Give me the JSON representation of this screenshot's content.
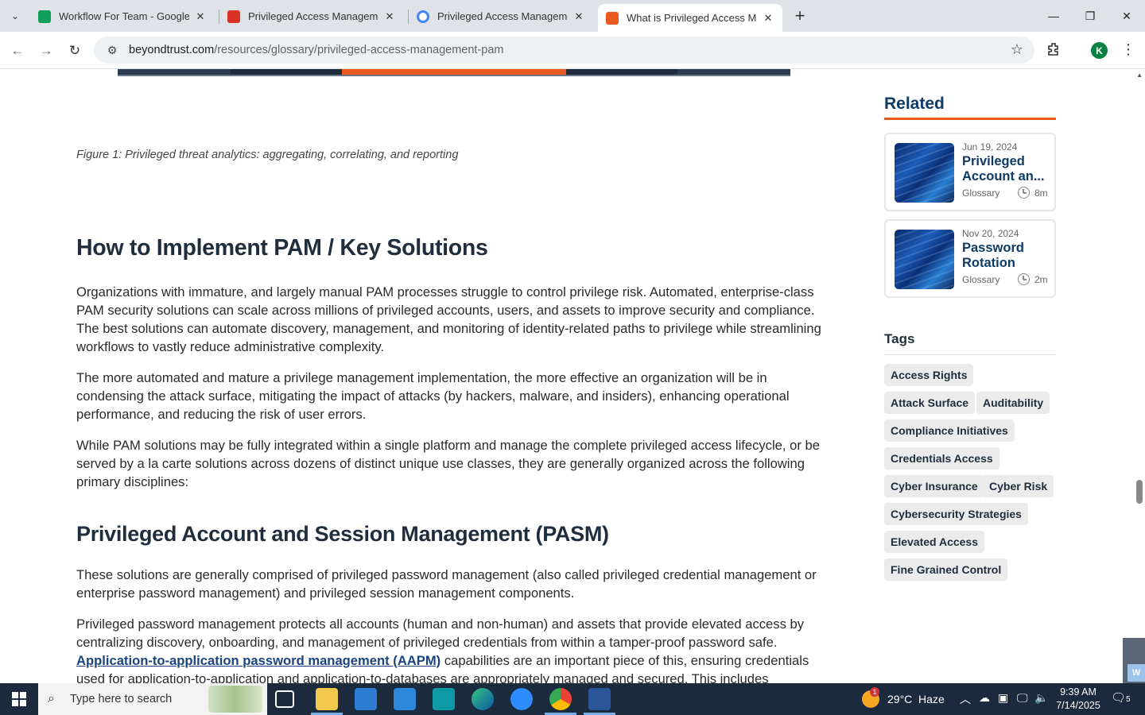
{
  "browser": {
    "tabs": [
      {
        "title": "Workflow For Team - Google Sh",
        "favicon_color": "#0f9d58"
      },
      {
        "title": "Privileged Access Management",
        "favicon_color": "#d93025"
      },
      {
        "title": "Privileged Access Management",
        "favicon_color": "#4285f4"
      },
      {
        "title": "What is Privileged Access Mana",
        "favicon_color": "#e8581f"
      }
    ],
    "url_host": "beyondtrust.com",
    "url_path": "/resources/glossary/privileged-access-management-pam",
    "profile_initial": "K"
  },
  "article": {
    "figure_caption": "Figure 1: Privileged threat analytics: aggregating, correlating, and reporting",
    "heading_1": "How to Implement PAM / Key Solutions",
    "para_1": "Organizations with immature, and largely manual PAM processes struggle to control privilege risk. Automated, enterprise-class PAM security solutions can scale across millions of privileged accounts, users, and assets to improve security and compliance. The best solutions can automate discovery, management, and monitoring of identity-related paths to privilege while streamlining workflows to vastly reduce administrative complexity.",
    "para_2": "The more automated and mature a privilege management implementation, the more effective an organization will be in condensing the attack surface, mitigating the impact of attacks (by hackers, malware, and insiders), enhancing operational performance, and reducing the risk of user errors.",
    "para_3": "While PAM solutions may be fully integrated within a single platform and manage the complete privileged access lifecycle, or be served by a la carte solutions across dozens of distinct unique use classes, they are generally organized across the following primary disciplines:",
    "heading_2": "Privileged Account and Session Management (PASM)",
    "para_4": "These solutions are generally comprised of privileged password management (also called privileged credential management or enterprise password management) and privileged session management components.",
    "para_5_a": "Privileged password management protects all accounts (human and non-human) and assets that provide elevated access by centralizing discovery, onboarding, and management of privileged credentials from within a tamper-proof password safe. ",
    "para_5_link": "Application-to-application password management (AAPM)",
    "para_5_b": " capabilities are an important piece of this, ensuring credentials used for application-to-application and application-to-databases are appropriately managed and secured. This includes"
  },
  "sidebar": {
    "related_heading": "Related",
    "related": [
      {
        "date": "Jun 19, 2024",
        "title": "Privileged Account an...",
        "type": "Glossary",
        "duration": "8m"
      },
      {
        "date": "Nov 20, 2024",
        "title": "Password Rotation",
        "type": "Glossary",
        "duration": "2m"
      }
    ],
    "tags_heading": "Tags",
    "tags": [
      "Access Rights",
      "Attack Surface",
      "Auditability",
      "Compliance Initiatives",
      "Credentials Access",
      "Cyber Insurance",
      "Cyber Risk",
      "Cybersecurity Strategies",
      "Elevated Access",
      "Fine Grained Control"
    ]
  },
  "taskbar": {
    "search_placeholder": "Type here to search",
    "weather": "29°C  Haze",
    "weather_badge": "1",
    "time": "9:39 AM",
    "date": "7/14/2025",
    "notification_count": "5"
  }
}
